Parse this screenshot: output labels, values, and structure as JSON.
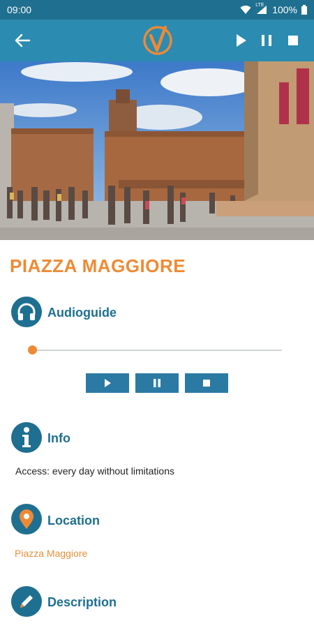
{
  "status_bar": {
    "time": "09:00",
    "battery": "100%",
    "network": "LTE"
  },
  "toolbar": {
    "back_icon": "arrow-left-icon",
    "logo": "check-logo",
    "play_icon": "play-icon",
    "pause_icon": "pause-icon",
    "stop_icon": "stop-icon"
  },
  "place": {
    "title": "PIAZZA MAGGIORE"
  },
  "audioguide": {
    "label": "Audioguide",
    "progress": 0.0
  },
  "info": {
    "label": "Info",
    "text": "Access: every day without limitations"
  },
  "location": {
    "label": "Location",
    "text": "Piazza Maggiore"
  },
  "description": {
    "label": "Description"
  },
  "colors": {
    "primary": "#2b8bb0",
    "dark": "#1f6f90",
    "accent": "#ee8a35"
  }
}
